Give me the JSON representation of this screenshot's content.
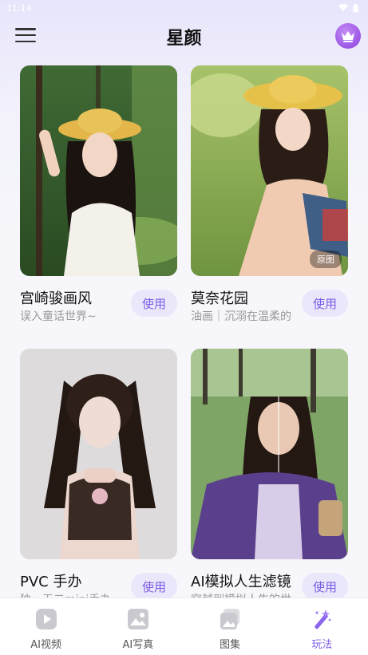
{
  "status_bar": {
    "time": "11:14"
  },
  "app_bar": {
    "title": "星颜",
    "menu_icon": "hamburger-menu-icon",
    "vip_icon": "crown-icon"
  },
  "cards": [
    {
      "title": "宫崎骏画风",
      "desc": "误入童话世界~",
      "button": "使用",
      "badge": ""
    },
    {
      "title": "莫奈花园",
      "desc": "油画｜沉溺在温柔的",
      "button": "使用",
      "badge": "原图"
    },
    {
      "title": "PVC 手办",
      "desc": "独一无二mini手办",
      "button": "使用",
      "badge": ""
    },
    {
      "title": "AI模拟人生滤镜",
      "desc": "穿越到模拟人生的世",
      "button": "使用",
      "badge": ""
    }
  ],
  "bottom_nav": [
    {
      "label": "AI视频",
      "icon": "video-play-icon",
      "active": false
    },
    {
      "label": "AI写真",
      "icon": "image-icon",
      "active": false
    },
    {
      "label": "图集",
      "icon": "album-icon",
      "active": false
    },
    {
      "label": "玩法",
      "icon": "magic-wand-icon",
      "active": true
    }
  ],
  "colors": {
    "accent": "#7b5ce6",
    "button_bg": "#ebe7fb",
    "background": "#f7f7fb"
  }
}
